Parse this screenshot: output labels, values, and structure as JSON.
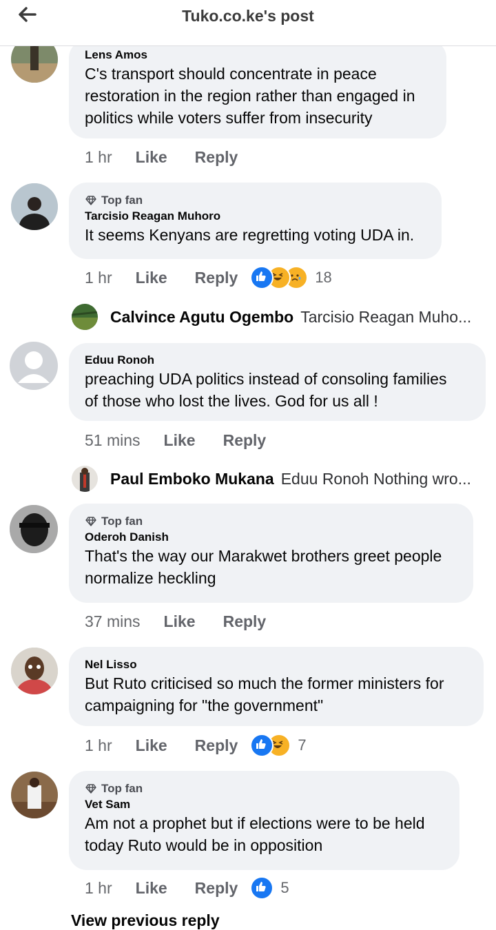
{
  "header": {
    "title": "Tuko.co.ke's post",
    "back_icon": "arrow-left-icon"
  },
  "colors": {
    "like_blue": "#1877f2",
    "haha_yellow": "#f7b125",
    "bubble_bg": "#f0f2f5",
    "meta_gray": "#65676b"
  },
  "comments": [
    {
      "author": "Lens Amos",
      "top_fan": false,
      "text_lines": [
        "C's transport should concentrate in peace",
        "restoration in the region rather than engaged in",
        "politics while voters suffer from insecurity"
      ],
      "time": "1 hr",
      "like": "Like",
      "reply": "Reply",
      "reactions": [],
      "reaction_count": ""
    },
    {
      "author": "Tarcisio Reagan Muhoro",
      "top_fan": true,
      "top_fan_label": "Top fan",
      "text_lines": [
        "It seems Kenyans are regretting voting UDA in."
      ],
      "time": "1 hr",
      "like": "Like",
      "reply": "Reply",
      "reactions": [
        "like",
        "haha",
        "sad"
      ],
      "reaction_count": "18",
      "reply_preview": {
        "name": "Calvince Agutu Ogembo",
        "text": "Tarcisio Reagan Muho..."
      }
    },
    {
      "author": "Eduu Ronoh",
      "top_fan": false,
      "text_lines": [
        "preaching UDA politics instead of consoling families",
        "of those who lost the lives.  God for us all !"
      ],
      "time": "51 mins",
      "like": "Like",
      "reply": "Reply",
      "reactions": [],
      "reaction_count": "",
      "reply_preview": {
        "name": "Paul Emboko Mukana",
        "text": "Eduu Ronoh Nothing wro..."
      }
    },
    {
      "author": "Oderoh Danish",
      "top_fan": true,
      "top_fan_label": "Top fan",
      "text_lines": [
        "That's the way our Marakwet brothers greet people",
        "normalize heckling"
      ],
      "time": "37 mins",
      "like": "Like",
      "reply": "Reply",
      "reactions": [],
      "reaction_count": ""
    },
    {
      "author": "Nel Lisso",
      "top_fan": false,
      "text_lines": [
        "But Ruto criticised so much the former ministers for",
        "campaigning for \"the government\""
      ],
      "time": "1 hr",
      "like": "Like",
      "reply": "Reply",
      "reactions": [
        "like",
        "haha"
      ],
      "reaction_count": "7"
    },
    {
      "author": "Vet Sam",
      "top_fan": true,
      "top_fan_label": "Top fan",
      "text_lines": [
        "Am not a prophet but if elections were to be held",
        "today Ruto would be in opposition"
      ],
      "time": "1 hr",
      "like": "Like",
      "reply": "Reply",
      "reactions": [
        "like"
      ],
      "reaction_count": "5"
    }
  ],
  "footer": {
    "view_previous": "View previous reply"
  }
}
